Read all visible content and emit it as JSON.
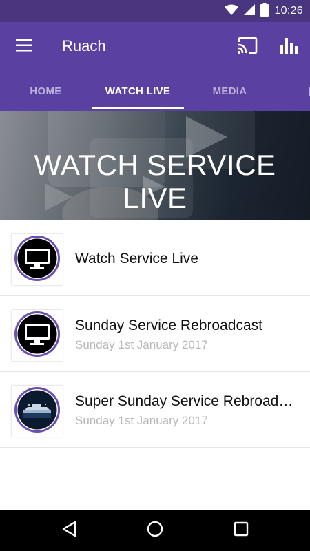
{
  "status_bar": {
    "time": "10:26"
  },
  "app_bar": {
    "title": "Ruach"
  },
  "tabs": [
    {
      "label": "HOME",
      "active": false
    },
    {
      "label": "WATCH LIVE",
      "active": true
    },
    {
      "label": "MEDIA",
      "active": false
    }
  ],
  "banner": {
    "title": "WATCH SERVICE LIVE"
  },
  "items": [
    {
      "title": "Watch Service Live",
      "subtitle": "",
      "thumb": "monitor-icon"
    },
    {
      "title": "Sunday Service Rebroadcast",
      "subtitle": "Sunday 1st January 2017",
      "thumb": "monitor-icon"
    },
    {
      "title": "Super Sunday Service Rebroadcast",
      "subtitle": "Sunday 1st January 2017",
      "thumb": "ship-image"
    }
  ],
  "colors": {
    "primary": "#5a40a0",
    "status_bar": "#4a357f",
    "ring": "#6b4fb0"
  }
}
